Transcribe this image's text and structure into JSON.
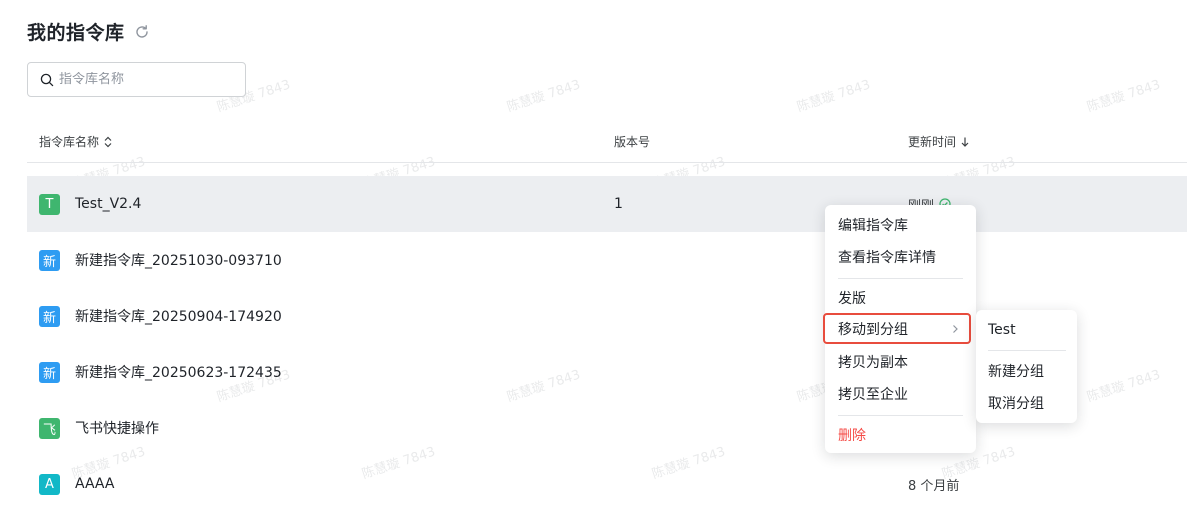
{
  "page": {
    "title": "我的指令库"
  },
  "search": {
    "placeholder": "指令库名称"
  },
  "table": {
    "columns": [
      "指令库名称",
      "版本号",
      "更新时间"
    ],
    "rows": [
      {
        "badge": "T",
        "badge_color": "#3fb66f",
        "name": "Test_V2.4",
        "version": "1",
        "updated": "刚刚"
      },
      {
        "badge": "新",
        "badge_color": "#2e9cf2",
        "name": "新建指令库_20251030-093710",
        "version": "",
        "updated": ""
      },
      {
        "badge": "新",
        "badge_color": "#2e9cf2",
        "name": "新建指令库_20250904-174920",
        "version": "",
        "updated": ""
      },
      {
        "badge": "新",
        "badge_color": "#2e9cf2",
        "name": "新建指令库_20250623-172435",
        "version": "",
        "updated": ""
      },
      {
        "badge": "飞",
        "badge_color": "#3fb66f",
        "name": "飞书快捷操作",
        "version": "",
        "updated": ""
      },
      {
        "badge": "A",
        "badge_color": "#12b8c7",
        "name": "AAAA",
        "version": "",
        "updated": "8 个月前"
      }
    ]
  },
  "context_menu": {
    "items": [
      "编辑指令库",
      "查看指令库详情",
      "发版",
      "移动到分组",
      "拷贝为副本",
      "拷贝至企业",
      "删除"
    ],
    "submenu": [
      "Test",
      "新建分组",
      "取消分组"
    ]
  },
  "watermark": {
    "text": "陈慧璇 7843"
  },
  "colors": {
    "success": "#3fb66f",
    "danger": "#f54a45",
    "highlight_border": "#e84c3d"
  }
}
